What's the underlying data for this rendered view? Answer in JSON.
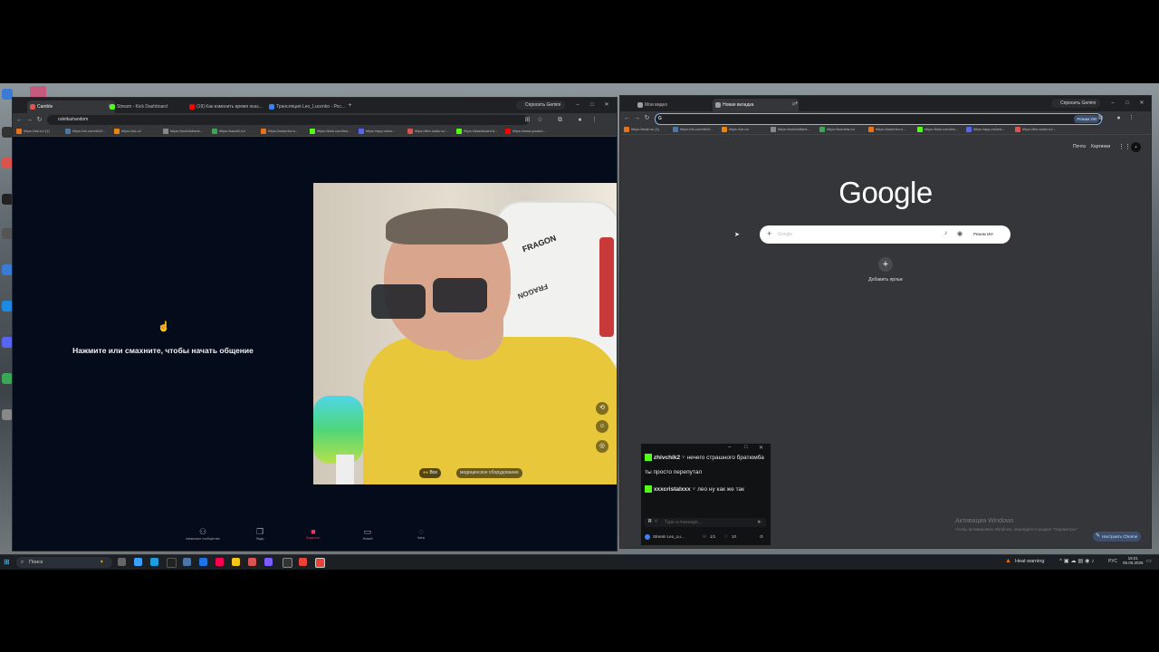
{
  "left_window": {
    "tabs": [
      {
        "label": "Camble",
        "color": "#d9534f"
      },
      {
        "label": "Stream - Kick Dashboard",
        "color": "#53fc18"
      },
      {
        "label": "(19) Как изменить время оказ...",
        "color": "#ff0000"
      },
      {
        "label": "Трансляция Leo_Lucenko - Рос...",
        "color": "#3b82f6"
      }
    ],
    "gemini": "Спросить Gemini",
    "url": "ruletka/random",
    "bookmarks": [
      {
        "label": "https://wk.ru/ (1)",
        "color": "#e8711a"
      },
      {
        "label": "https://vk.com/id10...",
        "color": "#4a76a8"
      },
      {
        "label": "https://ok.ru/",
        "color": "#ee8208"
      },
      {
        "label": "https://worldofrank...",
        "color": "#888888"
      },
      {
        "label": "https://saub0.ru/",
        "color": "#3aa757"
      },
      {
        "label": "https://www.itv.ru...",
        "color": "#e8711a"
      },
      {
        "label": "https://kick.com/leo...",
        "color": "#53fc18"
      },
      {
        "label": "https://app.voice...",
        "color": "#5865f2"
      },
      {
        "label": "https://the-radio.ru/...",
        "color": "#d9534f"
      },
      {
        "label": "https://dashboard.d...",
        "color": "#53fc18"
      },
      {
        "label": "https://www.youtub...",
        "color": "#ff0000"
      }
    ],
    "prompt_text": "Нажмите или смахните, чтобы начать общение",
    "video_filter_all": "Все",
    "video_filter_med": "медицинское оборудование",
    "chair_brand": "FRAGON",
    "bottom_nav": [
      {
        "label": "свежиское сообщество",
        "icon": "people-icon"
      },
      {
        "label": "Люди",
        "icon": "swipe-icon"
      },
      {
        "label": "Видеочат",
        "icon": "video-chat-icon",
        "active": true
      },
      {
        "label": "Новый",
        "icon": "message-icon"
      },
      {
        "label": "Чаты",
        "icon": "chats-icon"
      }
    ]
  },
  "right_window": {
    "tabs": [
      {
        "label": "Мои видео",
        "color": "#9aa0a6"
      },
      {
        "label": "Новая вкладка",
        "color": "#9aa0a6"
      }
    ],
    "gemini": "Спросить Gemini",
    "ai_mode": "Режим ИИ",
    "bookmarks": [
      {
        "label": "https://mail.ru/ (1)",
        "color": "#e8711a"
      },
      {
        "label": "https://vk.com/id10...",
        "color": "#4a76a8"
      },
      {
        "label": "https://ok.ru/",
        "color": "#ee8208"
      },
      {
        "label": "https://worldoftank...",
        "color": "#888888"
      },
      {
        "label": "https://kometa.ru/",
        "color": "#3aa757"
      },
      {
        "label": "https://www.itv.ru...",
        "color": "#e8711a"
      },
      {
        "label": "https://kick.com/leo...",
        "color": "#53fc18"
      },
      {
        "label": "https://app.voicea...",
        "color": "#5865f2"
      },
      {
        "label": "https://the-radio.ru/...",
        "color": "#d9534f"
      }
    ],
    "header_links": [
      "Почта",
      "Картинки"
    ],
    "google_logo": "Google",
    "search_placeholder": "Google",
    "search_ai_mode": "Режим ИИ",
    "add_shortcut": "Добавить ярлык",
    "customize": "Настроить Chrome",
    "activation_title": "Активация Windows",
    "activation_sub": "Чтобы активировать Windows, перейдите в раздел \"Параметры\"."
  },
  "chat_popup": {
    "messages": [
      {
        "user": "zhivchik2",
        "text": "нечего страшного братюмба ты просто перепутал"
      },
      {
        "user": "xxxcristalxxx",
        "text": "лео ну как же так"
      }
    ],
    "input_placeholder": "Type a message...",
    "stream_label": "Stream Leo_Lu...",
    "viewers": "1/1",
    "likes": "10"
  },
  "taskbar": {
    "search_placeholder": "Поиск",
    "heat_warning": "Heat warning",
    "lang": "РУС",
    "time": "19:21",
    "date": "06.06.2025"
  }
}
